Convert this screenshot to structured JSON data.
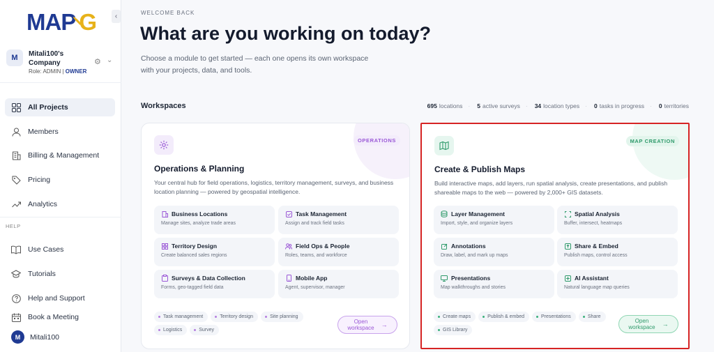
{
  "sidebar": {
    "logo_text": "MAPOG",
    "company_name": "Mitali100's Company",
    "role_prefix": "Role: ADMIN |",
    "role_owner": "OWNER",
    "nav_items": [
      {
        "label": "All Projects",
        "icon": "grid-icon",
        "active": true
      },
      {
        "label": "Members",
        "icon": "user-icon"
      },
      {
        "label": "Billing & Management",
        "icon": "building-icon"
      },
      {
        "label": "Pricing",
        "icon": "tag-icon"
      },
      {
        "label": "Analytics",
        "icon": "trend-icon"
      }
    ],
    "help_label": "HELP",
    "help_items": [
      {
        "label": "Use Cases",
        "icon": "book-icon"
      },
      {
        "label": "Tutorials",
        "icon": "graduation-icon"
      },
      {
        "label": "Help and Support",
        "icon": "question-icon"
      },
      {
        "label": "Book a Meeting",
        "icon": "calendar-icon"
      }
    ],
    "user_initial": "M",
    "user_name": "Mitali100"
  },
  "main": {
    "eyebrow": "WELCOME BACK",
    "title": "What are you working on today?",
    "subtitle": "Choose a module to get started — each one opens its own workspace with your projects, data, and tools.",
    "workspaces_title": "Workspaces",
    "stats": [
      {
        "value": "695",
        "label": "locations"
      },
      {
        "value": "5",
        "label": "active surveys"
      },
      {
        "value": "34",
        "label": "location types"
      },
      {
        "value": "0",
        "label": "tasks in progress"
      },
      {
        "value": "0",
        "label": "territories"
      }
    ]
  },
  "cards": [
    {
      "badge": "OPERATIONS",
      "title": "Operations & Planning",
      "description": "Your central hub for field operations, logistics, territory management, surveys, and business location planning — powered by geospatial intelligence.",
      "tiles": [
        {
          "title": "Business Locations",
          "desc": "Manage sites, analyze trade areas"
        },
        {
          "title": "Task Management",
          "desc": "Assign and track field tasks"
        },
        {
          "title": "Territory Design",
          "desc": "Create balanced sales regions"
        },
        {
          "title": "Field Ops & People",
          "desc": "Roles, teams, and workforce"
        },
        {
          "title": "Surveys & Data Collection",
          "desc": "Forms, geo-tagged field data"
        },
        {
          "title": "Mobile App",
          "desc": "Agent, supervisor, manager"
        }
      ],
      "tags": [
        "Task management",
        "Territory design",
        "Site planning",
        "Logistics",
        "Survey"
      ],
      "open_line1": "Open",
      "open_line2": "workspace"
    },
    {
      "badge": "MAP CREATION",
      "title": "Create & Publish Maps",
      "description": "Build interactive maps, add layers, run spatial analysis, create presentations, and publish shareable maps to the web — powered by 2,000+ GIS datasets.",
      "tiles": [
        {
          "title": "Layer Management",
          "desc": "Import, style, and organize layers"
        },
        {
          "title": "Spatial Analysis",
          "desc": "Buffer, intersect, heatmaps"
        },
        {
          "title": "Annotations",
          "desc": "Draw, label, and mark up maps"
        },
        {
          "title": "Share & Embed",
          "desc": "Publish maps, control access"
        },
        {
          "title": "Presentations",
          "desc": "Map walkthroughs and stories"
        },
        {
          "title": "AI Assistant",
          "desc": "Natural language map queries"
        }
      ],
      "tags": [
        "Create maps",
        "Publish & embed",
        "Presentations",
        "Share",
        "GIS Library"
      ],
      "open_line1": "Open",
      "open_line2": "workspace"
    }
  ]
}
